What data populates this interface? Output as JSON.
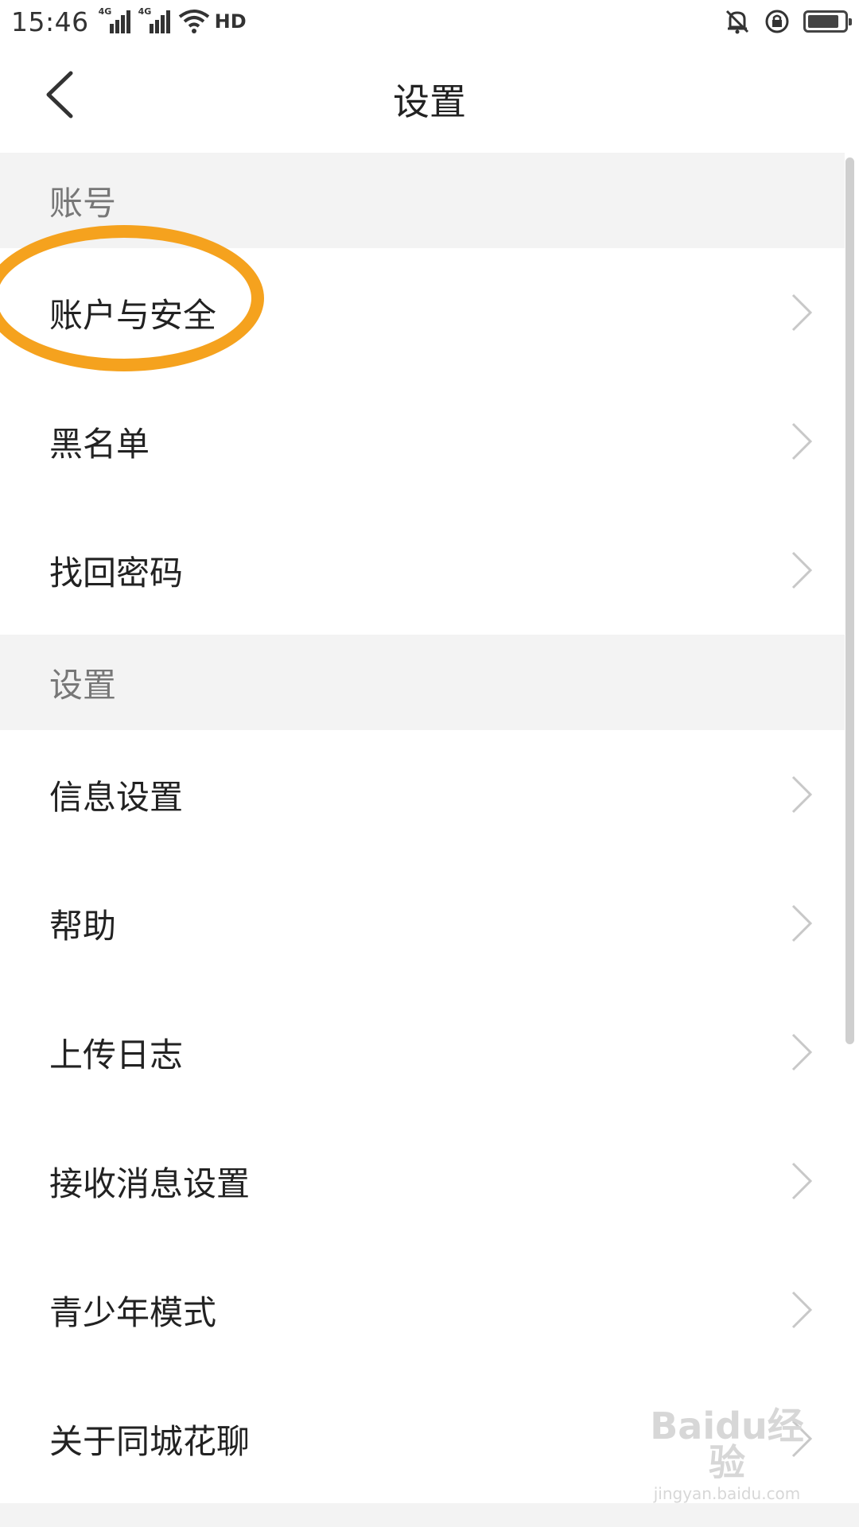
{
  "status_bar": {
    "time": "15:46",
    "signal1_label": "4G",
    "signal2_label": "4G",
    "hd_label": "HD",
    "icons": [
      "signal-icon",
      "wifi-icon",
      "hd-icon",
      "bell-off-icon",
      "rotation-lock-icon",
      "battery-icon"
    ]
  },
  "header": {
    "title": "设置"
  },
  "sections": [
    {
      "title": "账号",
      "items": [
        {
          "label": "账户与安全"
        },
        {
          "label": "黑名单"
        },
        {
          "label": "找回密码"
        }
      ]
    },
    {
      "title": "设置",
      "items": [
        {
          "label": "信息设置"
        },
        {
          "label": "帮助"
        },
        {
          "label": "上传日志"
        },
        {
          "label": "接收消息设置"
        },
        {
          "label": "青少年模式"
        },
        {
          "label": "关于同城花聊"
        }
      ]
    }
  ],
  "watermark": {
    "logo": "Baidu经验",
    "url": "jingyan.baidu.com"
  },
  "colors": {
    "accent_annotation": "#f5a21e",
    "section_bg": "#f3f3f3",
    "section_text": "#777777",
    "row_text": "#222222"
  }
}
